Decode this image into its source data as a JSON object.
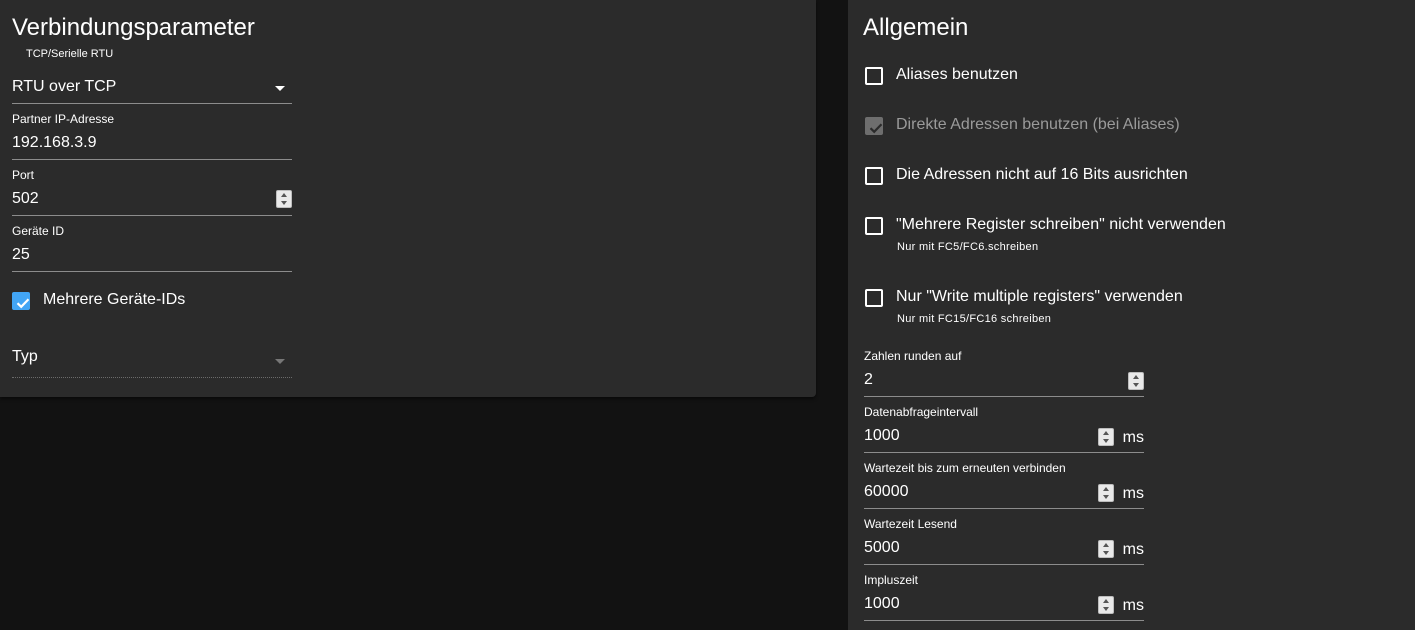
{
  "connection": {
    "title": "Verbindungsparameter",
    "type_label": "TCP/Serielle RTU",
    "type_value": "RTU over TCP",
    "ip_label": "Partner IP-Adresse",
    "ip_value": "192.168.3.9",
    "port_label": "Port",
    "port_value": "502",
    "device_id_label": "Geräte ID",
    "device_id_value": "25",
    "multi_ids_label": "Mehrere Geräte-IDs",
    "multi_ids_checked": true,
    "typ_label": "Typ"
  },
  "general": {
    "title": "Allgemein",
    "checkboxes": [
      {
        "label": "Aliases benutzen",
        "checked": false
      },
      {
        "label": "Direkte Adressen benutzen (bei Aliases)",
        "checked": true,
        "disabled": true
      },
      {
        "label": "Die Adressen nicht auf 16 Bits ausrichten",
        "checked": false
      },
      {
        "label": "\"Mehrere Register schreiben\" nicht verwenden",
        "help": "Nur mit FC5/FC6.schreiben",
        "checked": false
      },
      {
        "label": "Nur \"Write multiple registers\" verwenden",
        "help": "Nur mit FC15/FC16 schreiben",
        "checked": false
      }
    ],
    "fields": [
      {
        "label": "Zahlen runden auf",
        "value": "2"
      },
      {
        "label": "Datenabfrageintervall",
        "value": "1000",
        "unit": "ms"
      },
      {
        "label": "Wartezeit bis zum erneuten verbinden",
        "value": "60000",
        "unit": "ms"
      },
      {
        "label": "Wartezeit Lesend",
        "value": "5000",
        "unit": "ms"
      },
      {
        "label": "Impluszeit",
        "value": "1000",
        "unit": "ms"
      }
    ]
  },
  "colors": {
    "accent": "#42a5f5",
    "panel": "#2b2b2b",
    "background": "#121212"
  }
}
